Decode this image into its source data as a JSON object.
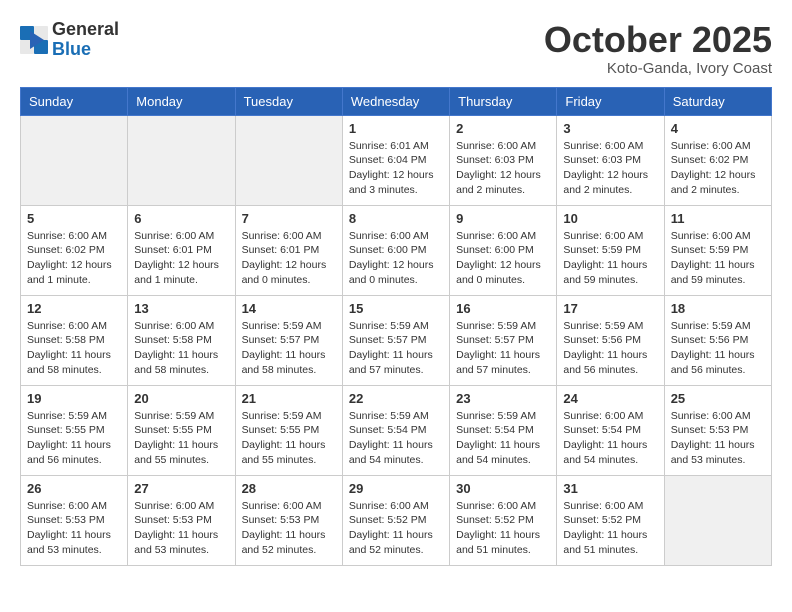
{
  "header": {
    "logo_general": "General",
    "logo_blue": "Blue",
    "month": "October 2025",
    "location": "Koto-Ganda, Ivory Coast"
  },
  "days_of_week": [
    "Sunday",
    "Monday",
    "Tuesday",
    "Wednesday",
    "Thursday",
    "Friday",
    "Saturday"
  ],
  "weeks": [
    [
      {
        "day": "",
        "info": ""
      },
      {
        "day": "",
        "info": ""
      },
      {
        "day": "",
        "info": ""
      },
      {
        "day": "1",
        "info": "Sunrise: 6:01 AM\nSunset: 6:04 PM\nDaylight: 12 hours and 3 minutes."
      },
      {
        "day": "2",
        "info": "Sunrise: 6:00 AM\nSunset: 6:03 PM\nDaylight: 12 hours and 2 minutes."
      },
      {
        "day": "3",
        "info": "Sunrise: 6:00 AM\nSunset: 6:03 PM\nDaylight: 12 hours and 2 minutes."
      },
      {
        "day": "4",
        "info": "Sunrise: 6:00 AM\nSunset: 6:02 PM\nDaylight: 12 hours and 2 minutes."
      }
    ],
    [
      {
        "day": "5",
        "info": "Sunrise: 6:00 AM\nSunset: 6:02 PM\nDaylight: 12 hours and 1 minute."
      },
      {
        "day": "6",
        "info": "Sunrise: 6:00 AM\nSunset: 6:01 PM\nDaylight: 12 hours and 1 minute."
      },
      {
        "day": "7",
        "info": "Sunrise: 6:00 AM\nSunset: 6:01 PM\nDaylight: 12 hours and 0 minutes."
      },
      {
        "day": "8",
        "info": "Sunrise: 6:00 AM\nSunset: 6:00 PM\nDaylight: 12 hours and 0 minutes."
      },
      {
        "day": "9",
        "info": "Sunrise: 6:00 AM\nSunset: 6:00 PM\nDaylight: 12 hours and 0 minutes."
      },
      {
        "day": "10",
        "info": "Sunrise: 6:00 AM\nSunset: 5:59 PM\nDaylight: 11 hours and 59 minutes."
      },
      {
        "day": "11",
        "info": "Sunrise: 6:00 AM\nSunset: 5:59 PM\nDaylight: 11 hours and 59 minutes."
      }
    ],
    [
      {
        "day": "12",
        "info": "Sunrise: 6:00 AM\nSunset: 5:58 PM\nDaylight: 11 hours and 58 minutes."
      },
      {
        "day": "13",
        "info": "Sunrise: 6:00 AM\nSunset: 5:58 PM\nDaylight: 11 hours and 58 minutes."
      },
      {
        "day": "14",
        "info": "Sunrise: 5:59 AM\nSunset: 5:57 PM\nDaylight: 11 hours and 58 minutes."
      },
      {
        "day": "15",
        "info": "Sunrise: 5:59 AM\nSunset: 5:57 PM\nDaylight: 11 hours and 57 minutes."
      },
      {
        "day": "16",
        "info": "Sunrise: 5:59 AM\nSunset: 5:57 PM\nDaylight: 11 hours and 57 minutes."
      },
      {
        "day": "17",
        "info": "Sunrise: 5:59 AM\nSunset: 5:56 PM\nDaylight: 11 hours and 56 minutes."
      },
      {
        "day": "18",
        "info": "Sunrise: 5:59 AM\nSunset: 5:56 PM\nDaylight: 11 hours and 56 minutes."
      }
    ],
    [
      {
        "day": "19",
        "info": "Sunrise: 5:59 AM\nSunset: 5:55 PM\nDaylight: 11 hours and 56 minutes."
      },
      {
        "day": "20",
        "info": "Sunrise: 5:59 AM\nSunset: 5:55 PM\nDaylight: 11 hours and 55 minutes."
      },
      {
        "day": "21",
        "info": "Sunrise: 5:59 AM\nSunset: 5:55 PM\nDaylight: 11 hours and 55 minutes."
      },
      {
        "day": "22",
        "info": "Sunrise: 5:59 AM\nSunset: 5:54 PM\nDaylight: 11 hours and 54 minutes."
      },
      {
        "day": "23",
        "info": "Sunrise: 5:59 AM\nSunset: 5:54 PM\nDaylight: 11 hours and 54 minutes."
      },
      {
        "day": "24",
        "info": "Sunrise: 6:00 AM\nSunset: 5:54 PM\nDaylight: 11 hours and 54 minutes."
      },
      {
        "day": "25",
        "info": "Sunrise: 6:00 AM\nSunset: 5:53 PM\nDaylight: 11 hours and 53 minutes."
      }
    ],
    [
      {
        "day": "26",
        "info": "Sunrise: 6:00 AM\nSunset: 5:53 PM\nDaylight: 11 hours and 53 minutes."
      },
      {
        "day": "27",
        "info": "Sunrise: 6:00 AM\nSunset: 5:53 PM\nDaylight: 11 hours and 53 minutes."
      },
      {
        "day": "28",
        "info": "Sunrise: 6:00 AM\nSunset: 5:53 PM\nDaylight: 11 hours and 52 minutes."
      },
      {
        "day": "29",
        "info": "Sunrise: 6:00 AM\nSunset: 5:52 PM\nDaylight: 11 hours and 52 minutes."
      },
      {
        "day": "30",
        "info": "Sunrise: 6:00 AM\nSunset: 5:52 PM\nDaylight: 11 hours and 51 minutes."
      },
      {
        "day": "31",
        "info": "Sunrise: 6:00 AM\nSunset: 5:52 PM\nDaylight: 11 hours and 51 minutes."
      },
      {
        "day": "",
        "info": ""
      }
    ]
  ]
}
